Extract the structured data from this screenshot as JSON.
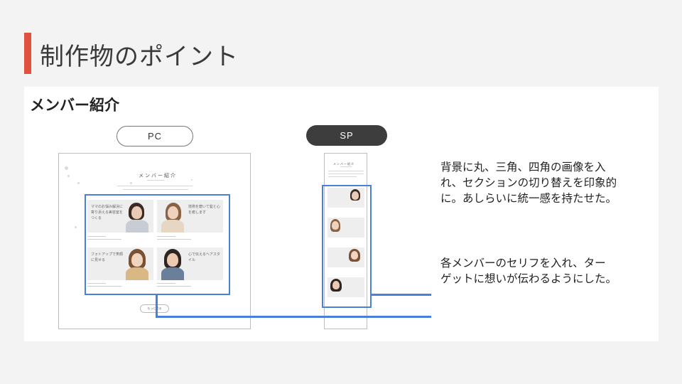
{
  "slide": {
    "title": "制作物のポイント",
    "accent_color": "#e0503c"
  },
  "section": {
    "heading": "メンバー紹介"
  },
  "tabs": {
    "pc_label": "PC",
    "sp_label": "SP"
  },
  "mockup": {
    "heading": "メンバー紹介",
    "more_label": "もっと見る",
    "members": [
      {
        "quote": "ママのお悩み解決に寄り添える美容室をつくる"
      },
      {
        "quote": "技術を磨いて髪と心を癒します"
      },
      {
        "quote": "フォトアップで笑顔に見せる"
      },
      {
        "quote": "心で伝えるヘアスタイル"
      }
    ]
  },
  "descriptions": {
    "background_note": [
      "背景に丸、三角、四角の画像を入",
      "れ、セクションの切り替えを印象的",
      "に。あしらいに統一感を持たせた。"
    ],
    "quote_note": [
      "各メンバーのセリフを入れ、ター",
      "ゲットに想いが伝わるようにした。"
    ]
  },
  "colors": {
    "highlight": "#4a7fdc",
    "pill_dark": "#3d3d3d"
  }
}
